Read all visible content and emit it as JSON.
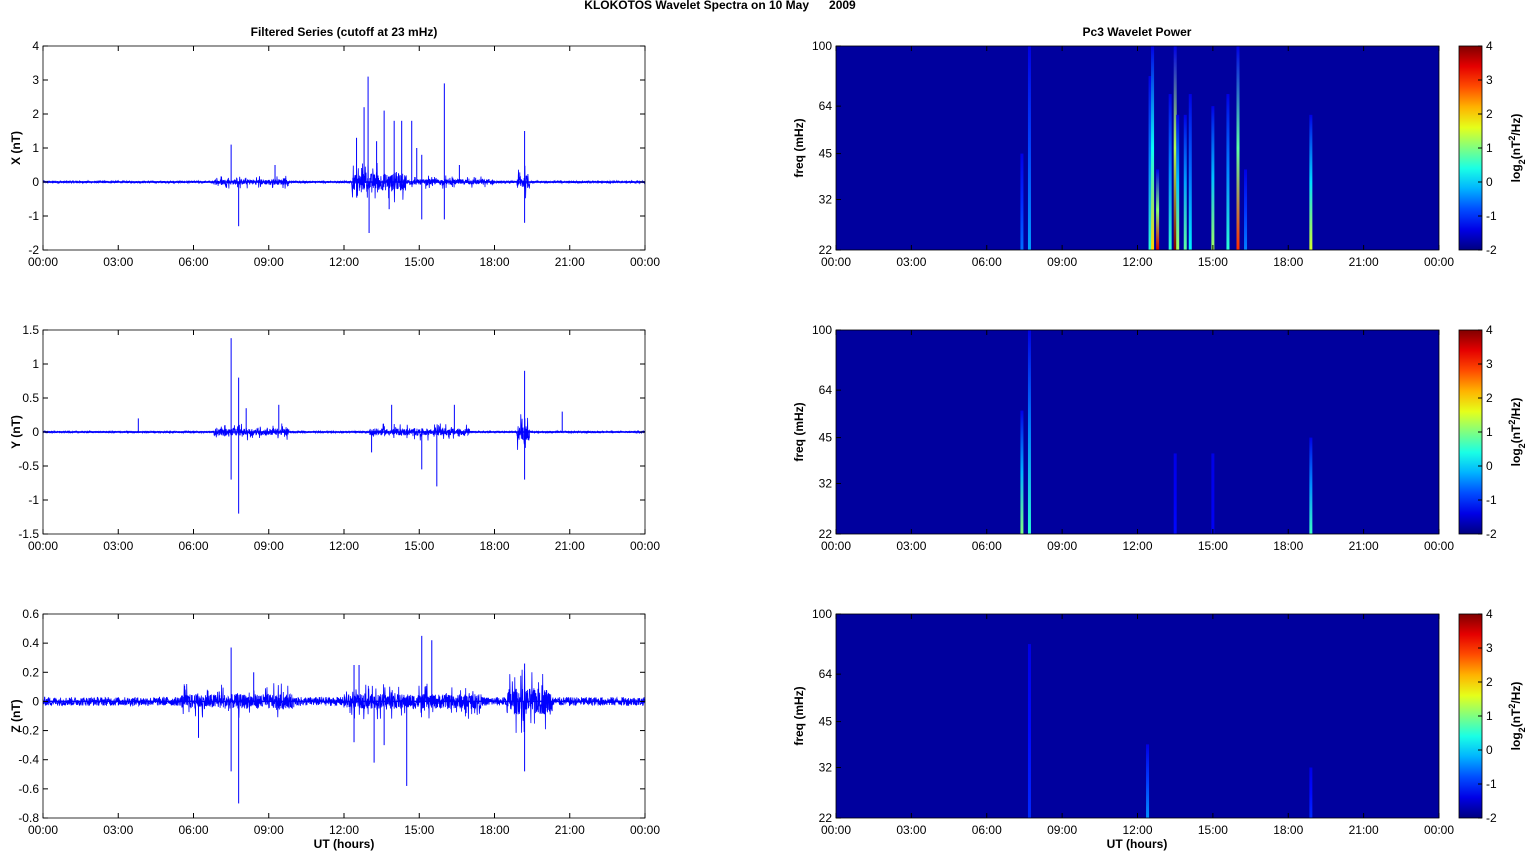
{
  "title": "KLOKOTOS Wavelet Spectra on 10 May      2009",
  "left_title": "Filtered Series (cutoff at 23 mHz)",
  "right_title": "Pc3 Wavelet Power",
  "xlabel": "UT (hours)",
  "time_ticks": [
    "00:00",
    "03:00",
    "06:00",
    "09:00",
    "12:00",
    "15:00",
    "18:00",
    "21:00",
    "00:00"
  ],
  "freq_label": "freq (mHz)",
  "colorbar_label_parts": [
    "log",
    "2",
    "(nT",
    "2",
    "/Hz)"
  ],
  "colorbar": {
    "range": [
      -2,
      4
    ],
    "ticks": [
      "4",
      "3",
      "2",
      "1",
      "0",
      "-1",
      "-2"
    ],
    "colormap": "jet"
  },
  "chart_data": [
    {
      "type": "line",
      "panel": "X",
      "ylabel": "X (nT)",
      "xlim": [
        0,
        24
      ],
      "ylim": [
        -2,
        4
      ],
      "yticks": [
        "4",
        "3",
        "2",
        "1",
        "0",
        "-1",
        "-2"
      ],
      "color": "#0000ff",
      "noise": 0.03,
      "active": [
        [
          6.8,
          9.8,
          0.08
        ],
        [
          12.3,
          14.5,
          0.25
        ],
        [
          14.5,
          18,
          0.08
        ],
        [
          18.9,
          19.4,
          0.2
        ]
      ],
      "spikes": [
        [
          7.5,
          1.1
        ],
        [
          7.8,
          -1.3
        ],
        [
          9.25,
          0.5
        ],
        [
          12.5,
          1.3
        ],
        [
          12.8,
          2.2
        ],
        [
          12.96,
          3.1
        ],
        [
          13.0,
          -1.5
        ],
        [
          13.3,
          1.2
        ],
        [
          13.6,
          2.1
        ],
        [
          14.0,
          1.8
        ],
        [
          14.3,
          1.8
        ],
        [
          14.7,
          1.8
        ],
        [
          15.1,
          0.8
        ],
        [
          15.1,
          -1.1
        ],
        [
          16.0,
          2.9
        ],
        [
          16.0,
          -1.1
        ],
        [
          16.6,
          0.5
        ],
        [
          19.2,
          1.5
        ],
        [
          19.2,
          -1.2
        ],
        [
          13.8,
          -0.8
        ],
        [
          14.9,
          1.0
        ]
      ]
    },
    {
      "type": "line",
      "panel": "Y",
      "ylabel": "Y (nT)",
      "xlim": [
        0,
        24
      ],
      "ylim": [
        -1.5,
        1.5
      ],
      "yticks": [
        "1.5",
        "1",
        "0.5",
        "0",
        "-0.5",
        "-1",
        "-1.5"
      ],
      "color": "#0000ff",
      "noise": 0.012,
      "active": [
        [
          6.8,
          9.8,
          0.05
        ],
        [
          13,
          17,
          0.05
        ],
        [
          18.9,
          19.4,
          0.12
        ]
      ],
      "spikes": [
        [
          7.5,
          1.38
        ],
        [
          7.5,
          -0.7
        ],
        [
          7.8,
          -1.2
        ],
        [
          7.8,
          0.8
        ],
        [
          8.1,
          0.35
        ],
        [
          9.4,
          0.4
        ],
        [
          13.1,
          -0.3
        ],
        [
          13.9,
          0.4
        ],
        [
          15.1,
          -0.55
        ],
        [
          15.7,
          -0.8
        ],
        [
          16.4,
          0.4
        ],
        [
          19.2,
          0.9
        ],
        [
          19.2,
          -0.7
        ],
        [
          20.7,
          0.3
        ],
        [
          3.8,
          0.2
        ]
      ]
    },
    {
      "type": "line",
      "panel": "Z",
      "ylabel": "Z (nT)",
      "xlim": [
        0,
        24
      ],
      "ylim": [
        -0.8,
        0.6
      ],
      "yticks": [
        "0.6",
        "0.4",
        "0.2",
        "0",
        "-0.2",
        "-0.4",
        "-0.6",
        "-0.8"
      ],
      "color": "#0000ff",
      "noise": 0.03,
      "active": [
        [
          5.5,
          10,
          0.05
        ],
        [
          12,
          17.5,
          0.05
        ],
        [
          18.5,
          20.3,
          0.09
        ]
      ],
      "spikes": [
        [
          7.5,
          0.37
        ],
        [
          7.5,
          -0.48
        ],
        [
          7.8,
          -0.7
        ],
        [
          12.4,
          0.25
        ],
        [
          12.4,
          -0.28
        ],
        [
          12.6,
          0.25
        ],
        [
          13.2,
          -0.42
        ],
        [
          13.6,
          -0.3
        ],
        [
          14.5,
          -0.58
        ],
        [
          15.1,
          0.45
        ],
        [
          15.5,
          0.42
        ],
        [
          19.2,
          0.26
        ],
        [
          19.2,
          -0.48
        ],
        [
          8.4,
          0.2
        ],
        [
          6.2,
          -0.25
        ]
      ]
    },
    {
      "type": "heatmap",
      "panel": "X",
      "xlim": [
        0,
        24
      ],
      "ylim_mHz": [
        22,
        100
      ],
      "yscale": "log",
      "yticks": [
        "100",
        "64",
        "45",
        "32",
        "22"
      ],
      "events": [
        [
          7.4,
          -0.6,
          45
        ],
        [
          7.7,
          -0.3,
          100
        ],
        [
          12.5,
          0.5,
          80
        ],
        [
          12.6,
          2.0,
          100
        ],
        [
          12.8,
          3.5,
          40
        ],
        [
          13.3,
          0.5,
          70
        ],
        [
          13.5,
          4.0,
          100
        ],
        [
          13.6,
          1.2,
          60
        ],
        [
          13.9,
          0.8,
          60
        ],
        [
          14.1,
          0.2,
          70
        ],
        [
          15.0,
          1.2,
          64
        ],
        [
          15.6,
          0.5,
          70
        ],
        [
          16.0,
          3.0,
          100
        ],
        [
          16.3,
          -0.5,
          40
        ],
        [
          18.9,
          1.5,
          60
        ]
      ]
    },
    {
      "type": "heatmap",
      "panel": "Y",
      "xlim": [
        0,
        24
      ],
      "ylim_mHz": [
        22,
        100
      ],
      "yscale": "log",
      "yticks": [
        "100",
        "64",
        "45",
        "32",
        "22"
      ],
      "events": [
        [
          7.4,
          1.0,
          55
        ],
        [
          7.7,
          0.5,
          100
        ],
        [
          13.5,
          -1.2,
          40
        ],
        [
          15.0,
          -1.3,
          40
        ],
        [
          18.9,
          0.6,
          45
        ]
      ]
    },
    {
      "type": "heatmap",
      "panel": "Z",
      "xlim": [
        0,
        24
      ],
      "ylim_mHz": [
        22,
        100
      ],
      "yscale": "log",
      "yticks": [
        "100",
        "64",
        "45",
        "32",
        "22"
      ],
      "events": [
        [
          7.7,
          -1.0,
          80
        ],
        [
          12.4,
          -0.4,
          38
        ],
        [
          18.9,
          -1.0,
          32
        ]
      ]
    }
  ]
}
